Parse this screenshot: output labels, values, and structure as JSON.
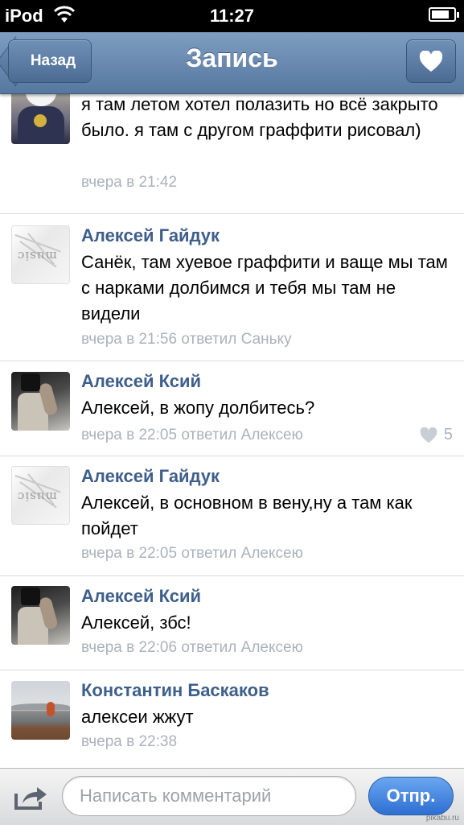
{
  "status_bar": {
    "device": "iPod",
    "time": "11:27",
    "battery_level": 0.8
  },
  "nav": {
    "back_label": "Назад",
    "title": "Запись"
  },
  "comments": [
    {
      "author": "",
      "text": "я там летом хотел полазить но всё закрыто было. я там с другом граффити рисовал)",
      "meta": "вчера в 21:42",
      "avatar": "panda-avatar"
    },
    {
      "author": "Алексей Гайдук",
      "text": "Санёк, там хуевое граффити и ваще мы там с нарками долбимся и тебя мы там не видели",
      "meta": "вчера в 21:56 ответил Саньку",
      "avatar": "music-avatar"
    },
    {
      "author": "Алексей Ксий",
      "text": "Алексей, в жопу долбитесь?",
      "meta": "вчера в 22:05 ответил Алексею",
      "likes": "5",
      "avatar": "person-avatar"
    },
    {
      "author": "Алексей Гайдук",
      "text": "Алексей, в основном в вену,ну а там как пойдет",
      "meta": "вчера в 22:05 ответил Алексею",
      "avatar": "music-avatar"
    },
    {
      "author": "Алексей Ксий",
      "text": "Алексей, збс!",
      "meta": "вчера в 22:06 ответил Алексею",
      "avatar": "person-avatar"
    },
    {
      "author": "Константин Баскаков",
      "text": "алексеи жжут",
      "meta": "вчера в 22:38",
      "avatar": "lake-avatar"
    }
  ],
  "composer": {
    "placeholder": "Написать комментарий",
    "send_label": "Отпр."
  },
  "watermark": "pikabu.ru",
  "colors": {
    "nav": "#5f82aa",
    "author": "#3e5f8a",
    "meta": "#aab2bd",
    "send": "#3a7fe0"
  }
}
